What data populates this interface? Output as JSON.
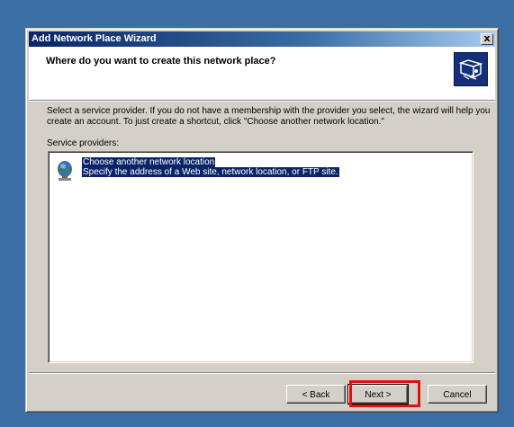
{
  "window": {
    "title": "Add Network Place Wizard",
    "close_label": "x"
  },
  "header": {
    "title": "Where do you want to create this network place?",
    "icon": "network-folder-icon"
  },
  "body": {
    "instructions": "Select a service provider.  If you do not have a membership with the provider you select, the wizard will help you create an account.  To just create a shortcut, click \"Choose another network location.\"",
    "service_providers_label": "Service providers:",
    "items": [
      {
        "title": "Choose another network location",
        "description": "Specify the address of a Web site, network location, or FTP site.",
        "icon": "network-globe-icon",
        "selected": true
      }
    ]
  },
  "buttons": {
    "back": "< Back",
    "next": "Next >",
    "cancel": "Cancel"
  },
  "colors": {
    "desktop": "#3a6ea5",
    "titlebar_start": "#0a246a",
    "selection": "#0a246a",
    "highlight_box": "#e01010"
  }
}
